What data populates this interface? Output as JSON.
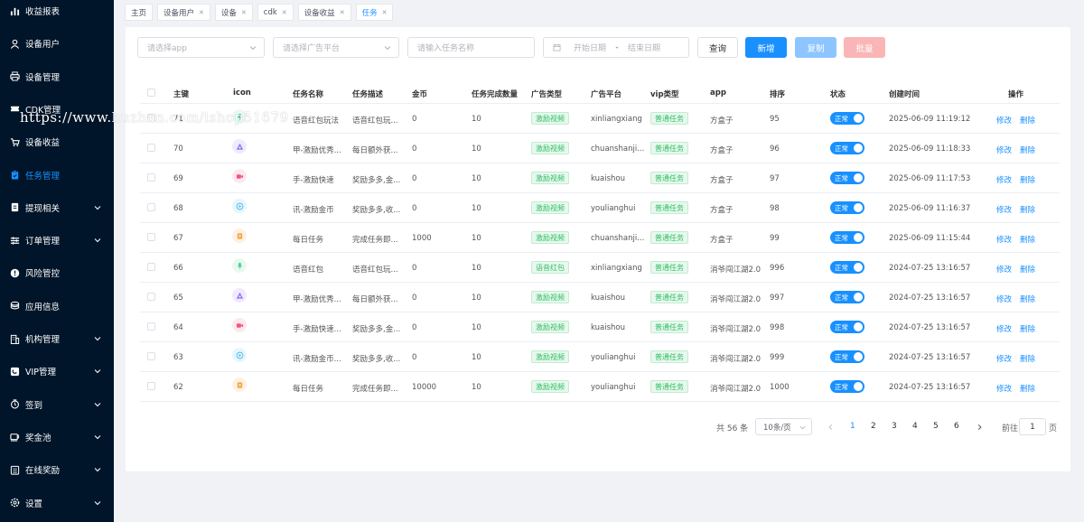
{
  "sidebar": {
    "items": [
      {
        "label": "收益报表",
        "icon": "bar-chart-icon",
        "has_children": false
      },
      {
        "label": "设备用户",
        "icon": "user-icon",
        "has_children": false
      },
      {
        "label": "设备管理",
        "icon": "printer-icon",
        "has_children": false
      },
      {
        "label": "CDK管理",
        "icon": "ticket-icon",
        "has_children": false
      },
      {
        "label": "设备收益",
        "icon": "cart-icon",
        "has_children": false
      },
      {
        "label": "任务管理",
        "icon": "clipboard-icon",
        "has_children": false,
        "active": true
      },
      {
        "label": "提现相关",
        "icon": "wallet-icon",
        "has_children": true
      },
      {
        "label": "订单管理",
        "icon": "list-icon",
        "has_children": true
      },
      {
        "label": "风险管控",
        "icon": "alert-icon",
        "has_children": false
      },
      {
        "label": "应用信息",
        "icon": "coins-icon",
        "has_children": false
      },
      {
        "label": "机构管理",
        "icon": "building-icon",
        "has_children": true
      },
      {
        "label": "VIP管理",
        "icon": "vip-icon",
        "has_children": true
      },
      {
        "label": "签到",
        "icon": "signin-icon",
        "has_children": true
      },
      {
        "label": "奖金池",
        "icon": "cup-icon",
        "has_children": true
      },
      {
        "label": "在线奖励",
        "icon": "gift-icon",
        "has_children": true
      },
      {
        "label": "设置",
        "icon": "gear-icon",
        "has_children": true
      }
    ]
  },
  "watermark": "https://www.huzhan.com/ishop51679",
  "tags": [
    {
      "label": "主页",
      "closable": false,
      "active": false
    },
    {
      "label": "设备用户",
      "closable": true,
      "active": false
    },
    {
      "label": "设备",
      "closable": true,
      "active": false
    },
    {
      "label": "cdk",
      "closable": true,
      "active": false
    },
    {
      "label": "设备收益",
      "closable": true,
      "active": false
    },
    {
      "label": "任务",
      "closable": true,
      "active": true
    }
  ],
  "filters": {
    "app_placeholder": "请选择app",
    "platform_placeholder": "请选择广告平台",
    "task_name_placeholder": "请输入任务名称",
    "start_date_placeholder": "开始日期",
    "date_separator": "-",
    "end_date_placeholder": "结束日期"
  },
  "buttons": {
    "query": "查询",
    "add": "新增",
    "copy": "复制",
    "batch": "批量"
  },
  "colors": {
    "sidebar_bg": "#001529",
    "primary": "#1890ff",
    "copy_btn": "#8cc5ff",
    "batch_btn": "#fab6b6",
    "tag_green": "#2fbf62"
  },
  "table": {
    "columns": [
      "主键",
      "icon",
      "任务名称",
      "任务描述",
      "金币",
      "任务完成数量",
      "广告类型",
      "广告平台",
      "vip类型",
      "app",
      "排序",
      "状态",
      "创建时间",
      "操作"
    ],
    "rows": [
      {
        "id": "71",
        "icon": "mic-icon",
        "name": "语音红包玩法",
        "desc": "语音红包玩...",
        "coins": "0",
        "count": "10",
        "ad_type": "激励视频",
        "platform": "xinliangxiang",
        "vip": "普通任务",
        "app": "方盒子",
        "sort": "95",
        "status": "正常",
        "created": "2025-06-09 11:19:12",
        "edit": "修改",
        "delete": "删除"
      },
      {
        "id": "70",
        "icon": "triangle-icon",
        "name": "甲-激励优秀...",
        "desc": "每日额外获...",
        "coins": "0",
        "count": "10",
        "ad_type": "激励视频",
        "platform": "chuanshanji...",
        "vip": "普通任务",
        "app": "方盒子",
        "sort": "96",
        "status": "正常",
        "created": "2025-06-09 11:18:33",
        "edit": "修改",
        "delete": "删除"
      },
      {
        "id": "69",
        "icon": "video-icon",
        "name": "手-激励快速",
        "desc": "奖励多多,金...",
        "coins": "0",
        "count": "10",
        "ad_type": "激励视频",
        "platform": "kuaishou",
        "vip": "普通任务",
        "app": "方盒子",
        "sort": "97",
        "status": "正常",
        "created": "2025-06-09 11:17:53",
        "edit": "修改",
        "delete": "删除"
      },
      {
        "id": "68",
        "icon": "play-icon",
        "name": "讯-激励金币",
        "desc": "奖励多多,收...",
        "coins": "0",
        "count": "10",
        "ad_type": "激励视频",
        "platform": "youlianghui",
        "vip": "普通任务",
        "app": "方盒子",
        "sort": "98",
        "status": "正常",
        "created": "2025-06-09 11:16:37",
        "edit": "修改",
        "delete": "删除"
      },
      {
        "id": "67",
        "icon": "coin-icon",
        "name": "每日任务",
        "desc": "完成任务即...",
        "coins": "1000",
        "count": "10",
        "ad_type": "激励视频",
        "platform": "chuanshanji...",
        "vip": "普通任务",
        "app": "方盒子",
        "sort": "99",
        "status": "正常",
        "created": "2025-06-09 11:15:44",
        "edit": "修改",
        "delete": "删除"
      },
      {
        "id": "66",
        "icon": "mic-icon",
        "name": "语音红包",
        "desc": "语音红包玩...",
        "coins": "0",
        "count": "10",
        "ad_type": "语音红包",
        "platform": "xinliangxiang",
        "vip": "普通任务",
        "app": "消爷闯江湖2.0",
        "sort": "996",
        "status": "正常",
        "created": "2024-07-25 13:16:57",
        "edit": "修改",
        "delete": "删除"
      },
      {
        "id": "65",
        "icon": "triangle-icon",
        "name": "甲-激励优秀...",
        "desc": "每日额外获...",
        "coins": "0",
        "count": "10",
        "ad_type": "激励视频",
        "platform": "kuaishou",
        "vip": "普通任务",
        "app": "消爷闯江湖2.0",
        "sort": "997",
        "status": "正常",
        "created": "2024-07-25 13:16:57",
        "edit": "修改",
        "delete": "删除"
      },
      {
        "id": "64",
        "icon": "video-icon",
        "name": "手-激励快速...",
        "desc": "奖励多多,金...",
        "coins": "0",
        "count": "10",
        "ad_type": "激励视频",
        "platform": "kuaishou",
        "vip": "普通任务",
        "app": "消爷闯江湖2.0",
        "sort": "998",
        "status": "正常",
        "created": "2024-07-25 13:16:57",
        "edit": "修改",
        "delete": "删除"
      },
      {
        "id": "63",
        "icon": "play-icon",
        "name": "讯-激励金币...",
        "desc": "奖励多多,收...",
        "coins": "0",
        "count": "10",
        "ad_type": "激励视频",
        "platform": "youlianghui",
        "vip": "普通任务",
        "app": "消爷闯江湖2.0",
        "sort": "999",
        "status": "正常",
        "created": "2024-07-25 13:16:57",
        "edit": "修改",
        "delete": "删除"
      },
      {
        "id": "62",
        "icon": "coin-icon",
        "name": "每日任务",
        "desc": "完成任务即...",
        "coins": "10000",
        "count": "10",
        "ad_type": "激励视频",
        "platform": "youlianghui",
        "vip": "普通任务",
        "app": "消爷闯江湖2.0",
        "sort": "1000",
        "status": "正常",
        "created": "2024-07-25 13:16:57",
        "edit": "修改",
        "delete": "删除"
      }
    ]
  },
  "pagination": {
    "total_text": "共 56 条",
    "page_size": "10条/页",
    "pages": [
      "1",
      "2",
      "3",
      "4",
      "5",
      "6"
    ],
    "current": "1",
    "goto_label": "前往",
    "goto_value": "1",
    "page_suffix": "页"
  }
}
